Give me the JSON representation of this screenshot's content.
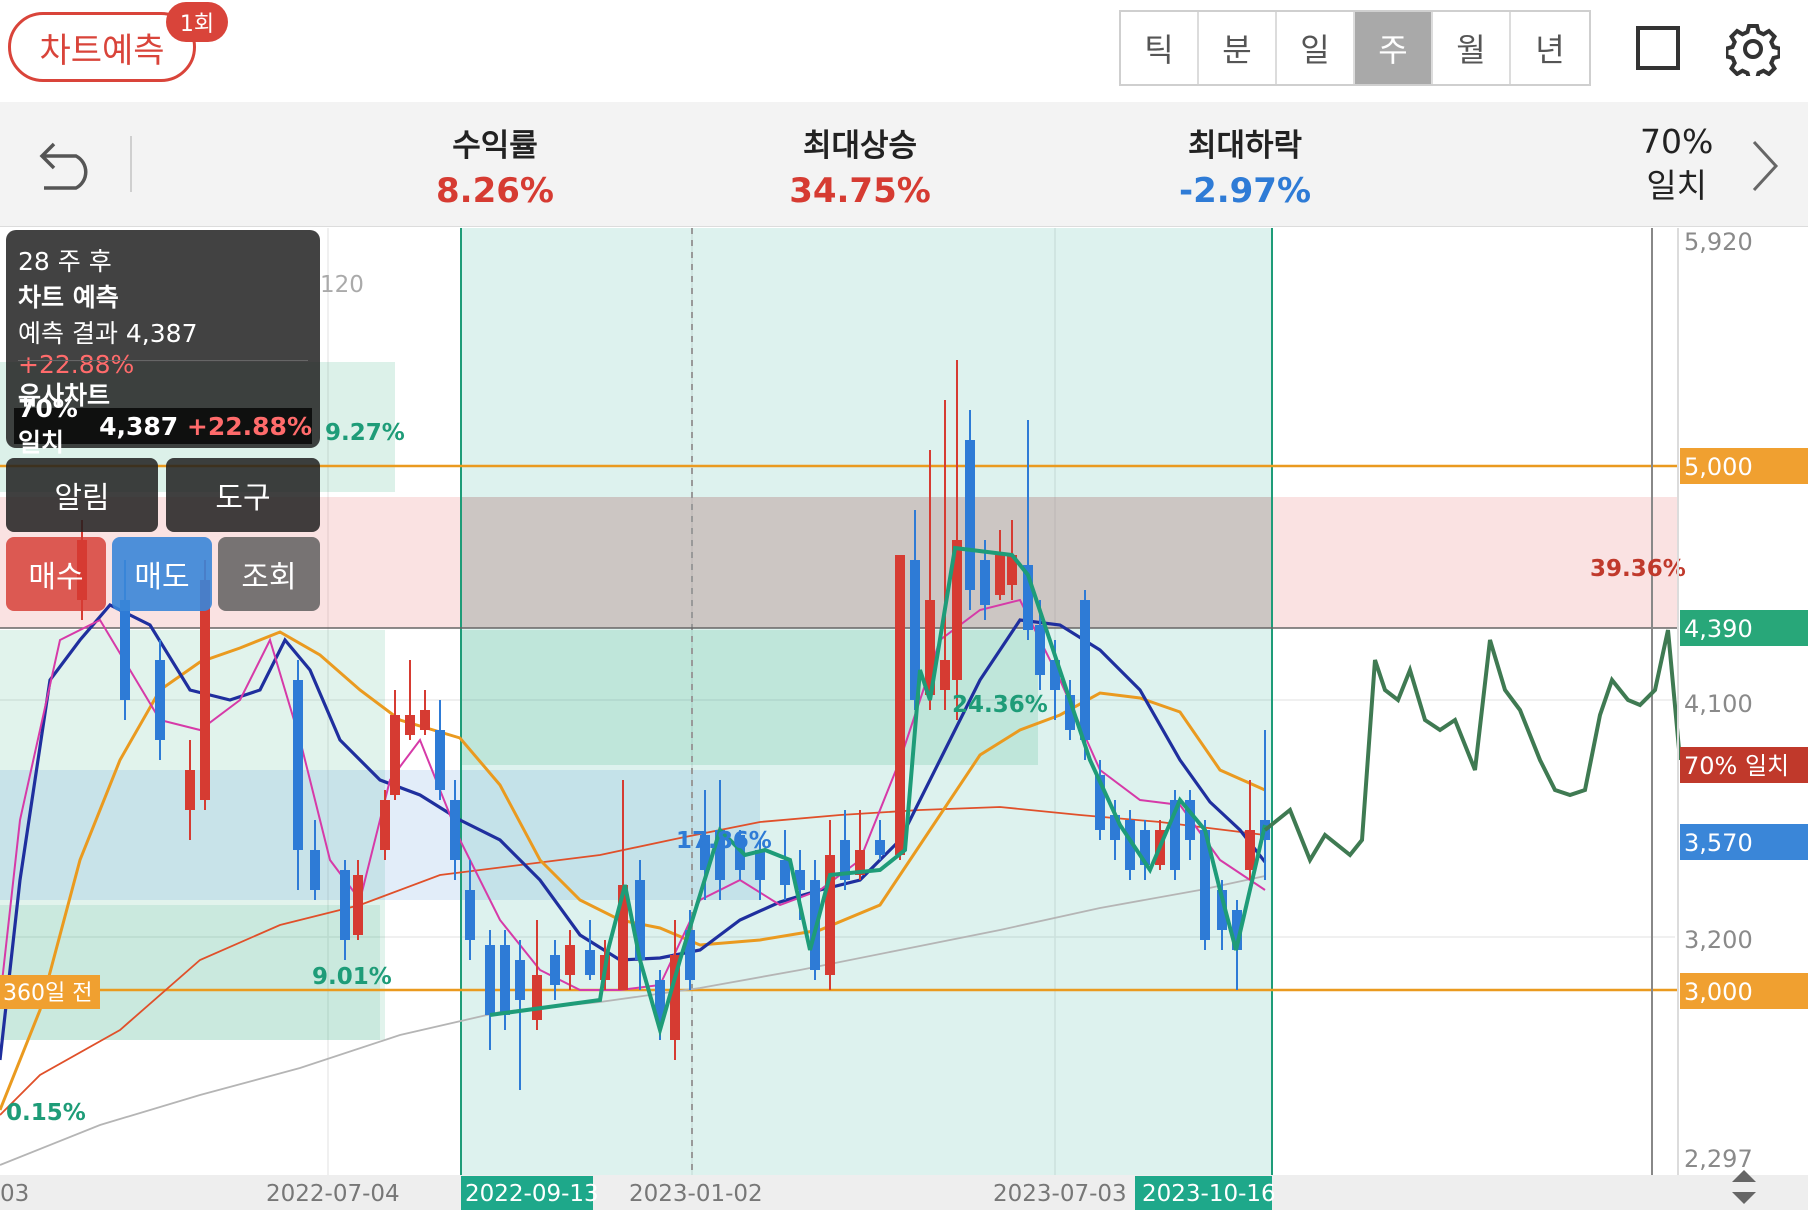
{
  "header": {
    "predict_button": "차트예측",
    "predict_badge": "1회",
    "periods": [
      "틱",
      "분",
      "일",
      "주",
      "월",
      "년"
    ],
    "active_period": "주"
  },
  "stats": {
    "return_label": "수익률",
    "return_value": "8.26%",
    "max_rise_label": "최대상승",
    "max_rise_value": "34.75%",
    "max_fall_label": "최대하락",
    "max_fall_value": "-2.97%",
    "match_pct": "70%",
    "match_label": "일치"
  },
  "tooltip": {
    "period": "28 주 후",
    "title": "차트 예측",
    "result_label": "예측 결과",
    "result_price": "4,387",
    "result_change": "+22.88%",
    "similar_title": "유사차트",
    "similar_label": "70% 일치",
    "similar_price": "4,387",
    "similar_change": "+22.88%"
  },
  "buttons": {
    "alert": "알림",
    "tools": "도구",
    "buy": "매수",
    "sell": "매도",
    "inquiry": "조회"
  },
  "chart": {
    "partial_legend_text": "120",
    "price_axis": [
      "5,920",
      "4,100",
      "3,200",
      "2,297"
    ],
    "price_tags": [
      {
        "label": "5,000",
        "color": "#f0a030"
      },
      {
        "label": "4,390",
        "color": "#28a779"
      },
      {
        "label": "70% 일치",
        "color": "#c0392b"
      },
      {
        "label": "3,570",
        "color": "#3a86d8"
      },
      {
        "label": "3,000",
        "color": "#f0a030"
      }
    ],
    "date_axis": [
      "03",
      "2022-07-04",
      "2023-01-02",
      "2023-07-03"
    ],
    "range_start": "2022-09-13",
    "range_end": "2023-10-16",
    "box_labels": [
      "9.27%",
      "9.01%",
      "0.15%",
      "17.86%",
      "24.36%"
    ],
    "red_zone_label": "39.36%",
    "line_label_360": "360일 전",
    "colors": {
      "up": "#d63b32",
      "down": "#2e7bd6",
      "ma5": "#d63aa8",
      "ma10": "#1f2f9e",
      "ma20": "#ea9a1f",
      "ma60": "#e0502a",
      "ma120": "#b5b5b5",
      "pattern": "#1e9c78",
      "forecast": "#3f7a52"
    }
  }
}
